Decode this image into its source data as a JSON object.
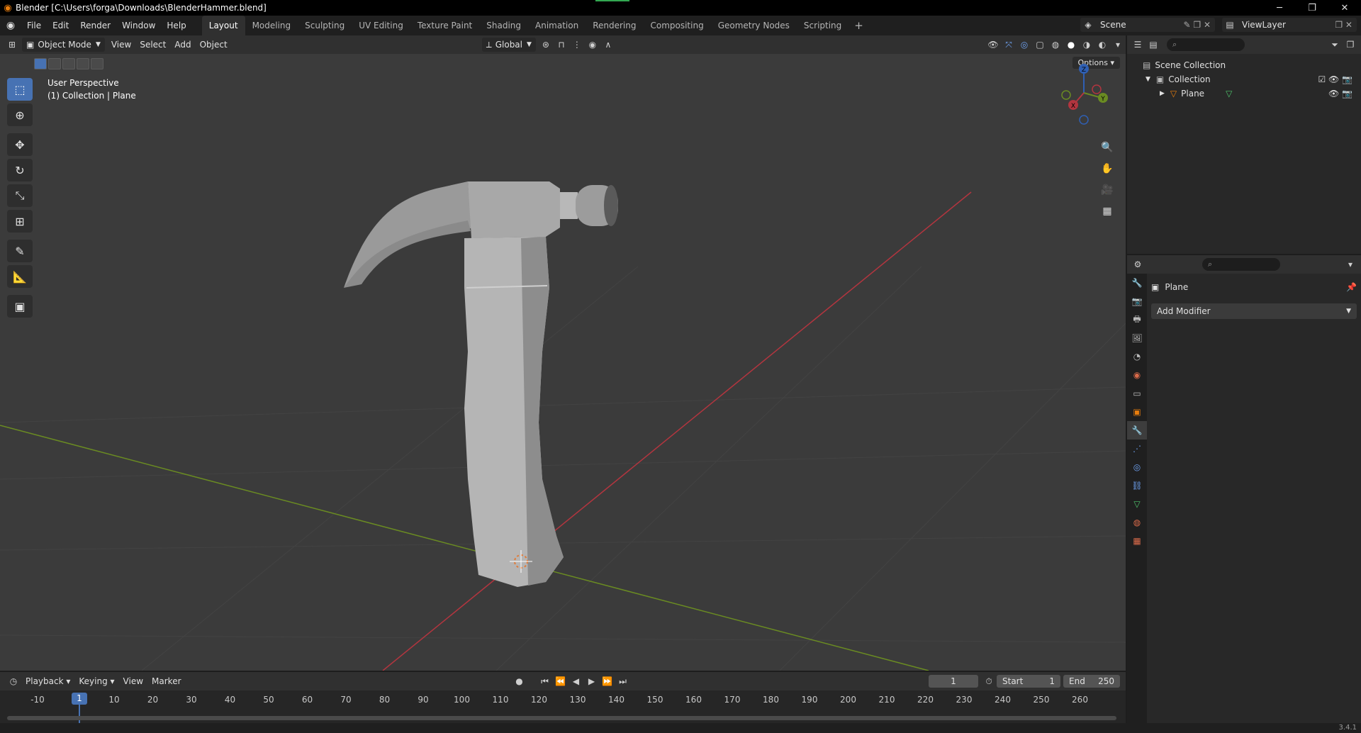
{
  "window": {
    "title": "Blender [C:\\Users\\forga\\Downloads\\BlenderHammer.blend]",
    "controls": [
      "─",
      "❐",
      "✕"
    ]
  },
  "menu": [
    "File",
    "Edit",
    "Render",
    "Window",
    "Help"
  ],
  "workspaces": [
    "Layout",
    "Modeling",
    "Sculpting",
    "UV Editing",
    "Texture Paint",
    "Shading",
    "Animation",
    "Rendering",
    "Compositing",
    "Geometry Nodes",
    "Scripting"
  ],
  "active_workspace": "Layout",
  "workspace_add": "+",
  "scene": {
    "name": "Scene",
    "view_layer": "ViewLayer"
  },
  "viewport_header": {
    "mode": "Object Mode",
    "menus": [
      "View",
      "Select",
      "Add",
      "Object"
    ],
    "orientation": "Global",
    "options": "Options"
  },
  "viewport": {
    "perspective_label": "User Perspective",
    "collection_label": "(1) Collection | Plane",
    "gizmo": {
      "x": "X",
      "y": "Y",
      "z": "Z"
    }
  },
  "outliner": {
    "scene_collection": "Scene Collection",
    "collection": "Collection",
    "object": "Plane"
  },
  "properties": {
    "object_name": "Plane",
    "add_modifier": "Add Modifier"
  },
  "timeline": {
    "menus": [
      "Playback",
      "Keying",
      "View",
      "Marker"
    ],
    "current_frame": "1",
    "start_label": "Start",
    "start_value": "1",
    "end_label": "End",
    "end_value": "250",
    "ticks": [
      "-10",
      "10",
      "20",
      "30",
      "40",
      "50",
      "60",
      "70",
      "80",
      "90",
      "100",
      "110",
      "120",
      "130",
      "140",
      "150",
      "160",
      "170",
      "180",
      "190",
      "200",
      "210",
      "220",
      "230",
      "240",
      "250",
      "260"
    ],
    "cursor_frame": "1"
  },
  "status": {
    "version": "3.4.1"
  },
  "colors": {
    "accent": "#4772b3",
    "x_axis": "#b3353f",
    "y_axis": "#6a8b22",
    "z_axis": "#2f5fb3"
  }
}
